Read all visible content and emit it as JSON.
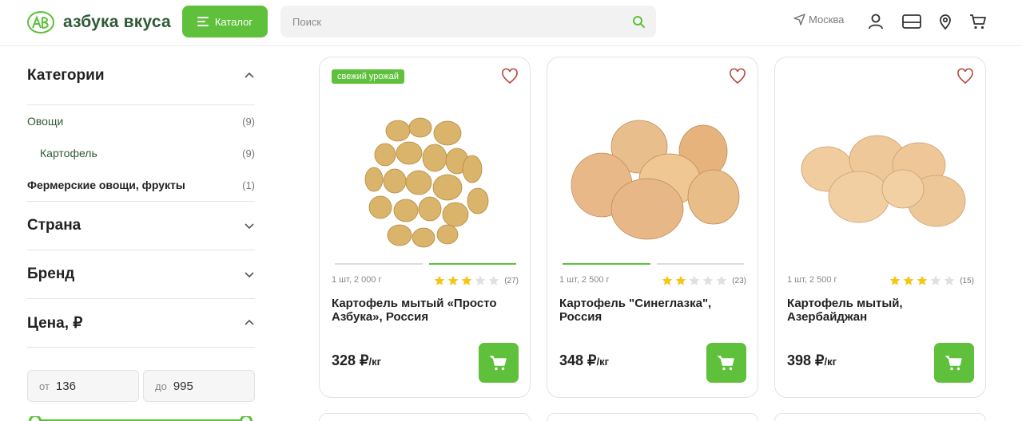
{
  "header": {
    "logo_text": "азбука вкуса",
    "catalog_label": "Каталог",
    "search_placeholder": "Поиск",
    "city": "Москва"
  },
  "sidebar": {
    "categories_title": "Категории",
    "categories": [
      {
        "label": "Овощи",
        "count": "(9)"
      },
      {
        "label": "Картофель",
        "count": "(9)"
      },
      {
        "label": "Фермерские овощи, фрукты",
        "count": "(1)"
      }
    ],
    "country_title": "Страна",
    "brand_title": "Бренд",
    "price_title": "Цена, ₽",
    "price_from_label": "от",
    "price_from": "136",
    "price_to_label": "до",
    "price_to": "995"
  },
  "products": [
    {
      "badge": "свежий урожай",
      "unit": "1 шт, 2 000 г",
      "rating": 3,
      "reviews": "(27)",
      "name": "Картофель мытый «Просто Азбука», Россия",
      "price": "328 ₽",
      "price_unit": "/кг",
      "active_image": 2,
      "images": 2
    },
    {
      "badge": "",
      "unit": "1 шт, 2 500 г",
      "rating": 2,
      "reviews": "(23)",
      "name": "Картофель \"Синеглазка\", Россия",
      "price": "348 ₽",
      "price_unit": "/кг",
      "active_image": 1,
      "images": 2
    },
    {
      "badge": "",
      "unit": "1 шт, 2 500 г",
      "rating": 3,
      "reviews": "(15)",
      "name": "Картофель мытый, Азербайджан",
      "price": "398 ₽",
      "price_unit": "/кг",
      "active_image": 0,
      "images": 0
    }
  ],
  "colors": {
    "accent": "#5ec03b",
    "brand_text": "#2f5a34",
    "star": "#f5c518",
    "star_empty": "#e0e0e0"
  },
  "icons": [
    "catalog-menu-icon",
    "search-icon",
    "location-arrow-icon",
    "user-icon",
    "card-icon",
    "map-pin-icon",
    "cart-icon",
    "heart-icon",
    "star-icon",
    "add-to-cart-icon"
  ]
}
